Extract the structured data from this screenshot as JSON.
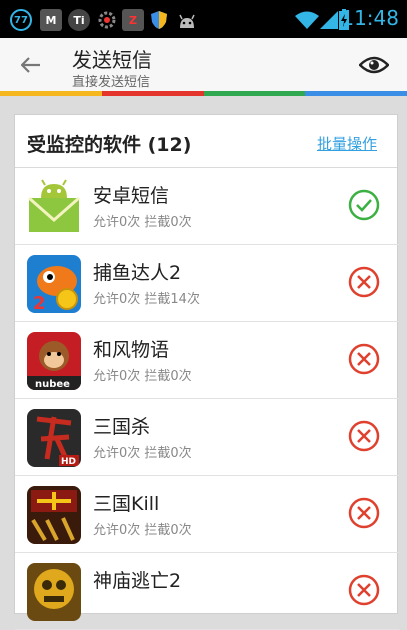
{
  "statusbar": {
    "time": "11:48",
    "icons": [
      "qq-77-icon",
      "mail-icon",
      "ti-icon",
      "gear-icon",
      "z-icon",
      "shield-icon",
      "android-icon",
      "wifi-icon",
      "signal-icon",
      "battery-icon"
    ]
  },
  "actionbar": {
    "title": "发送短信",
    "subtitle": "直接发送短信"
  },
  "colors": {
    "bar": [
      "#f5b71d",
      "#e3352c",
      "#2fa84f",
      "#3a8ee6"
    ],
    "allow": "#3cb043",
    "block": "#e0412f",
    "link": "#33a0e0"
  },
  "list": {
    "title": "受监控的软件 (12)",
    "batch_label": "批量操作",
    "apps": [
      {
        "name": "安卓短信",
        "stats": "允许0次 拦截0次",
        "status": "allowed",
        "icon": "android-sms-icon"
      },
      {
        "name": "捕鱼达人2",
        "stats": "允许0次 拦截14次",
        "status": "blocked",
        "icon": "fishing-joy-icon"
      },
      {
        "name": "和风物语",
        "stats": "允许0次 拦截0次",
        "status": "blocked",
        "icon": "nubee-monkey-icon"
      },
      {
        "name": "三国杀",
        "stats": "允许0次 拦截0次",
        "status": "blocked",
        "icon": "sanguosha-icon"
      },
      {
        "name": "三国Kill",
        "stats": "允许0次 拦截0次",
        "status": "blocked",
        "icon": "sanguo-kill-icon"
      },
      {
        "name": "神庙逃亡2",
        "stats": "",
        "status": "blocked",
        "icon": "temple-run-icon"
      }
    ]
  }
}
